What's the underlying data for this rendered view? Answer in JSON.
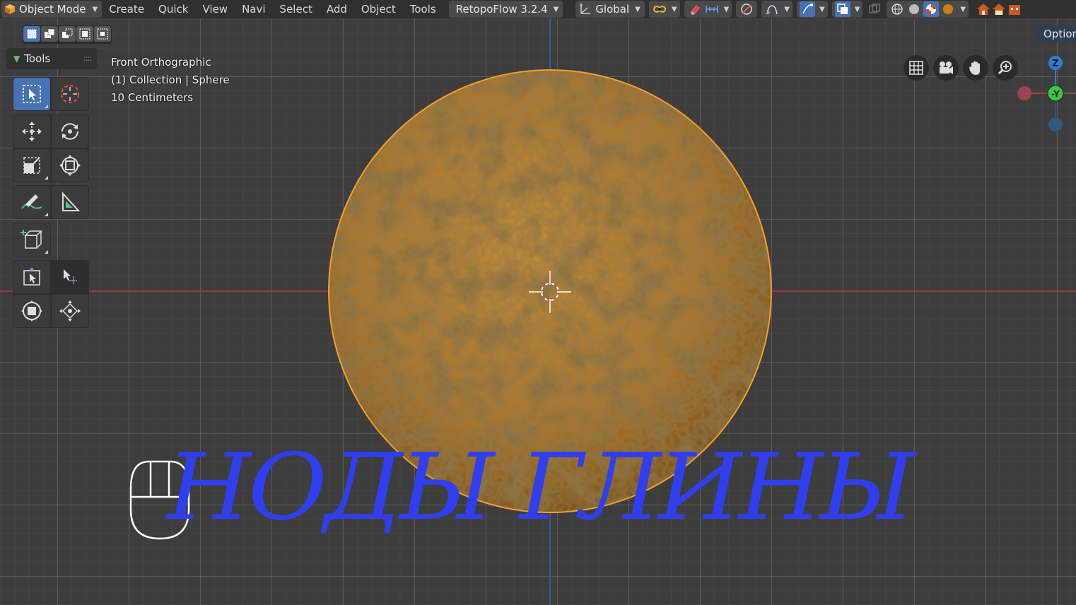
{
  "header": {
    "mode_label": "Object Mode",
    "menus": [
      "Create",
      "Quick",
      "View",
      "Navi",
      "Select",
      "Add",
      "Object",
      "Tools"
    ],
    "addon_label": "RetopoFlow 3.2.4",
    "orientation_label": "Global"
  },
  "viewport": {
    "options_label": "Option",
    "tools_label": "Tools",
    "info": {
      "view_name": "Front Orthographic",
      "collection": "(1) Collection | Sphere",
      "scale": "10 Centimeters"
    },
    "gizmo": {
      "z_label": "Z",
      "y_label": "-Y"
    },
    "overlay_title": "НОДЫ ГЛИНЫ"
  },
  "colors": {
    "accent": "#4772b3",
    "sphere": "#b07a2e",
    "selection_outline": "#f0a030",
    "overlay_text": "#2f3ff0",
    "x_axis": "#9a3b48",
    "z_axis": "#3d5f86"
  },
  "icons": {
    "tools": [
      "select-box-icon",
      "cursor-icon",
      "move-icon",
      "rotate-icon",
      "scale-icon",
      "transform-icon",
      "annotate-icon",
      "measure-icon",
      "add-cube-icon",
      "edit-select-icon",
      "tweak-icon",
      "shrink-icon",
      "push-pull-icon"
    ],
    "nav": [
      "grid-icon",
      "camera-icon",
      "hand-icon",
      "zoom-icon"
    ]
  }
}
